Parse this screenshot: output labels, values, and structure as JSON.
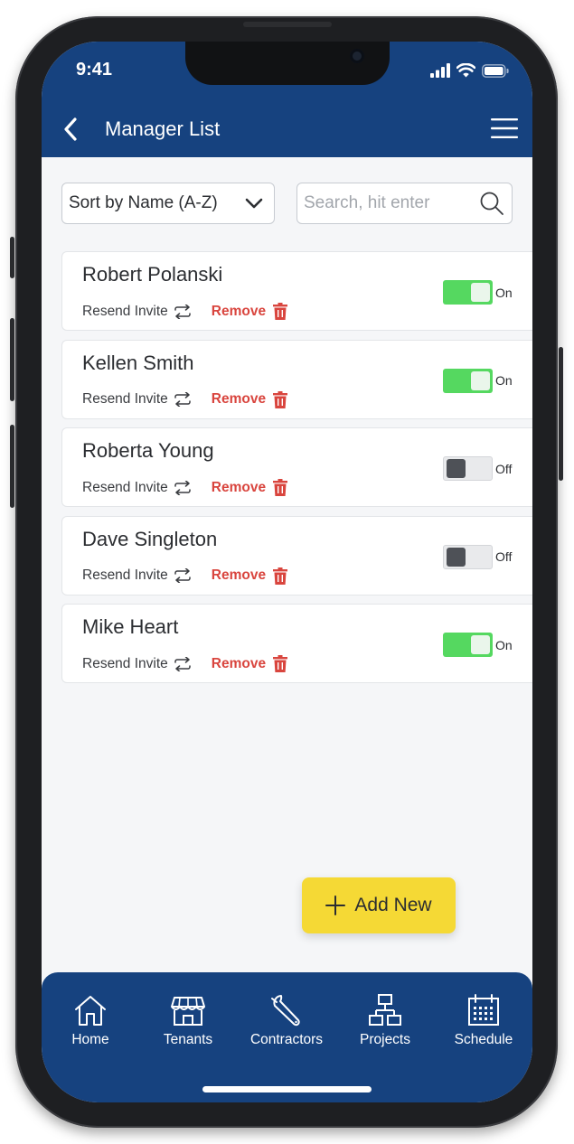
{
  "status_bar": {
    "time": "9:41"
  },
  "header": {
    "title": "Manager List"
  },
  "filters": {
    "sort_label": "Sort by Name (A-Z)",
    "search_placeholder": "Search, hit enter"
  },
  "managers": [
    {
      "name": "Robert Polanski",
      "resend": "Resend Invite",
      "remove": "Remove",
      "status": "On"
    },
    {
      "name": "Kellen Smith",
      "resend": "Resend Invite",
      "remove": "Remove",
      "status": "On"
    },
    {
      "name": "Roberta Young",
      "resend": "Resend Invite",
      "remove": "Remove",
      "status": "Off"
    },
    {
      "name": "Dave Singleton",
      "resend": "Resend Invite",
      "remove": "Remove",
      "status": "Off"
    },
    {
      "name": "Mike Heart",
      "resend": "Resend Invite",
      "remove": "Remove",
      "status": "On"
    }
  ],
  "add_button": {
    "label": "Add New"
  },
  "tabs": [
    {
      "label": "Home",
      "icon": "home-icon"
    },
    {
      "label": "Tenants",
      "icon": "storefront-icon"
    },
    {
      "label": "Contractors",
      "icon": "wrench-icon"
    },
    {
      "label": "Projects",
      "icon": "sitemap-icon"
    },
    {
      "label": "Schedule",
      "icon": "calendar-icon"
    }
  ],
  "colors": {
    "primary": "#16427f",
    "toggle_on": "#55d860",
    "remove": "#d9453e",
    "add_button": "#f5d935",
    "background": "#f5f6f8"
  }
}
